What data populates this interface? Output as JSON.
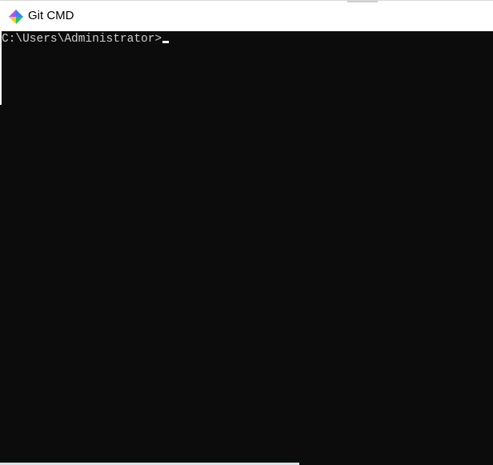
{
  "window": {
    "title": "Git CMD",
    "icon": "git-diamond-icon"
  },
  "console": {
    "prompt": "C:\\Users\\Administrator>",
    "background_color": "#0c0c0c",
    "text_color": "#cccccc"
  }
}
